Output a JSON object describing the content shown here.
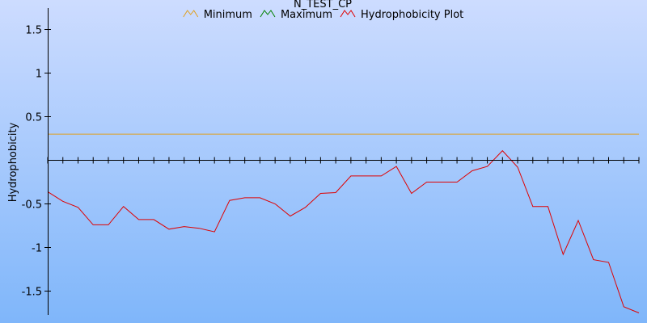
{
  "chart_data": {
    "type": "line",
    "title": "N_TEST_CP",
    "ylabel": "Hydrophobicity",
    "xlabel": "",
    "ylim": [
      -1.75,
      1.75
    ],
    "xlim": [
      0,
      39
    ],
    "yticks": [
      {
        "value": 1.5,
        "label": "1.5"
      },
      {
        "value": 1,
        "label": "1"
      },
      {
        "value": 0.5,
        "label": "0.5"
      },
      {
        "value": -0.5,
        "label": "-0.5"
      },
      {
        "value": -1,
        "label": "-1"
      },
      {
        "value": -1.5,
        "label": "-1.5"
      }
    ],
    "legend_position": "top",
    "series": [
      {
        "name": "Minimum",
        "color": "#e0a020",
        "icon": "zigzag-icon",
        "x": [
          0,
          39
        ],
        "y": [
          0.3,
          0.3
        ]
      },
      {
        "name": "Maximum",
        "color": "#008000",
        "icon": "zigzag-icon",
        "x": [],
        "y": []
      },
      {
        "name": "Hydrophobicity Plot",
        "color": "#e00000",
        "icon": "zigzag-icon",
        "x": [
          0,
          1,
          2,
          3,
          4,
          5,
          6,
          7,
          8,
          9,
          10,
          11,
          12,
          13,
          14,
          15,
          16,
          17,
          18,
          19,
          20,
          21,
          22,
          23,
          24,
          25,
          26,
          27,
          28,
          29,
          30,
          31,
          32,
          33,
          34,
          35,
          36,
          37,
          38,
          39
        ],
        "y": [
          -0.36,
          -0.47,
          -0.54,
          -0.74,
          -0.74,
          -0.53,
          -0.68,
          -0.68,
          -0.79,
          -0.76,
          -0.78,
          -0.82,
          -0.46,
          -0.43,
          -0.43,
          -0.5,
          -0.64,
          -0.54,
          -0.38,
          -0.37,
          -0.18,
          -0.18,
          -0.18,
          -0.07,
          -0.38,
          -0.25,
          -0.25,
          -0.25,
          -0.12,
          -0.07,
          0.11,
          -0.08,
          -0.53,
          -0.53,
          -1.08,
          -0.69,
          -1.14,
          -1.17,
          -1.68,
          -1.75
        ]
      }
    ]
  }
}
